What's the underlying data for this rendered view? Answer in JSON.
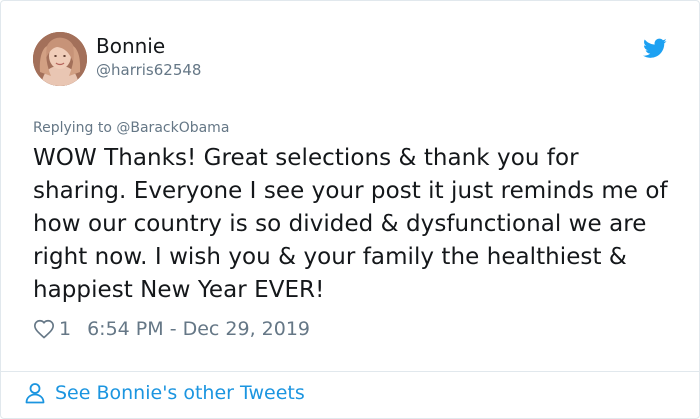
{
  "tweet": {
    "author": {
      "display_name": "Bonnie",
      "handle": "@harris62548"
    },
    "reply_to": "Replying to @BarackObama",
    "text": "WOW Thanks! Great selections & thank you for sharing. Everyone I see your post it just reminds me of how our country is so divided & dysfunctional we are right now. I wish you & your family the healthiest & happiest New Year EVER!",
    "like_count": "1",
    "timestamp": "6:54 PM - Dec 29, 2019",
    "footer_link": "See Bonnie's other Tweets"
  },
  "icons": {
    "brand": "twitter-bird-icon",
    "like": "heart-icon",
    "profile": "person-icon"
  },
  "colors": {
    "twitter_blue": "#1da1f2",
    "link_blue": "#1b95e0",
    "secondary_text": "#657786",
    "primary_text": "#14171a",
    "border": "#e1e8ed"
  }
}
